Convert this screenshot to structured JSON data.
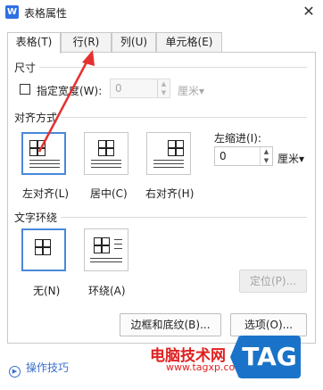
{
  "window": {
    "icon_letter": "W",
    "title": "表格属性",
    "close_glyph": "✕"
  },
  "tabs": [
    {
      "label": "表格(T)",
      "active": true
    },
    {
      "label": "行(R)",
      "active": false
    },
    {
      "label": "列(U)",
      "active": false
    },
    {
      "label": "单元格(E)",
      "active": false
    }
  ],
  "size": {
    "section_label": "尺寸",
    "width_checkbox_label": "指定宽度(W):",
    "width_value": "0",
    "width_unit": "厘米▾"
  },
  "alignment": {
    "section_label": "对齐方式",
    "options": [
      {
        "label": "左对齐(L)",
        "selected": true
      },
      {
        "label": "居中(C)",
        "selected": false
      },
      {
        "label": "右对齐(H)",
        "selected": false
      }
    ],
    "indent_label": "左缩进(I):",
    "indent_value": "0",
    "indent_unit": "厘米▾"
  },
  "wrapping": {
    "section_label": "文字环绕",
    "options": [
      {
        "label": "无(N)",
        "selected": true
      },
      {
        "label": "环绕(A)",
        "selected": false
      }
    ],
    "position_button": "定位(P)..."
  },
  "buttons": {
    "borders": "边框和底纹(B)...",
    "options": "选项(O)..."
  },
  "footer": {
    "tips_label": "操作技巧"
  },
  "watermark": {
    "site_text": "电脑技术网",
    "url": "www.tagxp.com",
    "tag": "TAG"
  },
  "colors": {
    "accent": "#4a88d9",
    "annotation_arrow": "#e53030",
    "link": "#3a6fc9"
  }
}
